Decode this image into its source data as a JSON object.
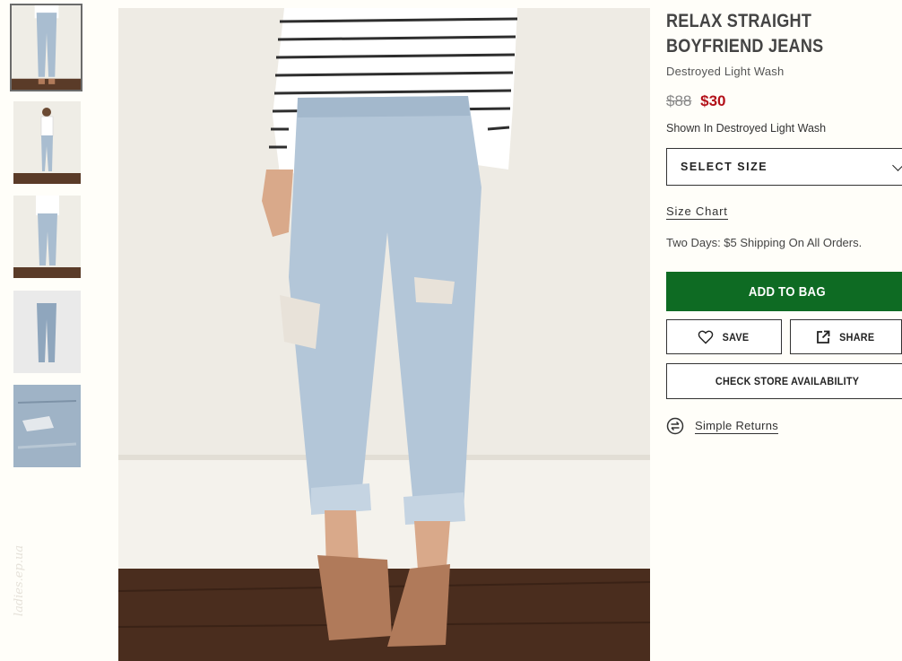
{
  "product": {
    "title": "RELAX STRAIGHT BOYFRIEND JEANS",
    "color_name": "Destroyed Light Wash",
    "price_original": "$88",
    "price_sale": "$30",
    "shown_in": "Shown In Destroyed Light Wash"
  },
  "size": {
    "select_label": "SELECT SIZE",
    "size_chart_link": "Size Chart"
  },
  "shipping_note": "Two Days: $5 Shipping On All Orders.",
  "actions": {
    "add_to_bag": "ADD TO BAG",
    "save": "SAVE",
    "share": "SHARE",
    "check_store": "CHECK STORE AVAILABILITY",
    "returns": "Simple Returns"
  },
  "gallery": {
    "thumbnails": [
      "front-view-cropped",
      "front-view-full",
      "front-view-full-alt",
      "flat-lay",
      "detail-closeup"
    ],
    "active_index": 0
  },
  "watermark": "ladies.ep.ua",
  "colors": {
    "add_to_bag_bg": "#0e6b23",
    "sale_price": "#b3111a",
    "original_price": "#888888"
  }
}
